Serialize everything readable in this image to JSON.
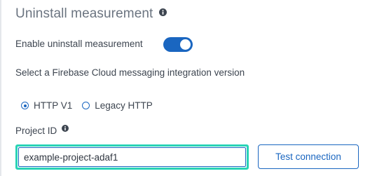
{
  "section": {
    "title": "Uninstall measurement",
    "info_icon": "info-icon"
  },
  "enable_toggle": {
    "label": "Enable uninstall measurement",
    "state": "on",
    "color": "#1a66c0"
  },
  "integration": {
    "prompt": "Select a Firebase Cloud messaging integration version",
    "options": [
      {
        "label": "HTTP V1",
        "selected": true
      },
      {
        "label": "Legacy HTTP",
        "selected": false
      }
    ]
  },
  "project": {
    "label": "Project ID",
    "info_icon": "info-icon",
    "value": "example-project-adaf1",
    "focus_ring_color": "#29d3b6"
  },
  "actions": {
    "test_connection_label": "Test connection"
  }
}
